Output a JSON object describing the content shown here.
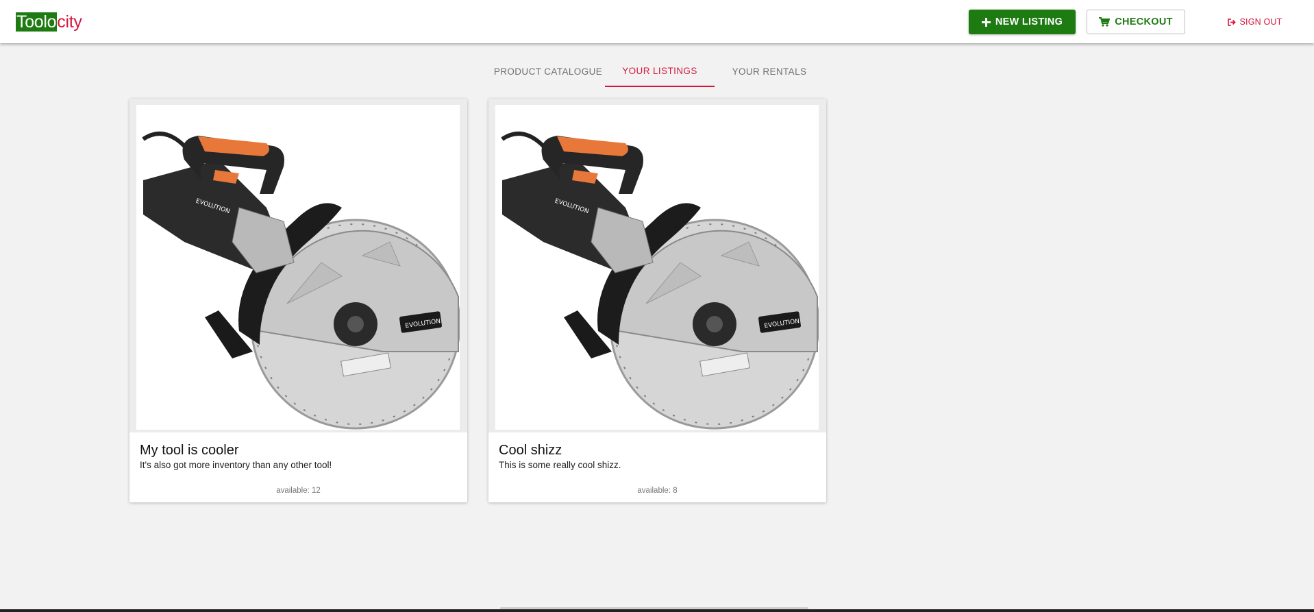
{
  "logo": {
    "part_highlight": "Toolo",
    "part_accent": "city"
  },
  "header": {
    "new_listing_label": "NEW LISTING",
    "checkout_label": "CHECKOUT",
    "sign_out_label": "SIGN OUT"
  },
  "tabs": [
    {
      "label": "PRODUCT CATALOGUE",
      "active": false
    },
    {
      "label": "YOUR LISTINGS",
      "active": true
    },
    {
      "label": "YOUR RENTALS",
      "active": false
    }
  ],
  "listings": [
    {
      "title": "My tool is cooler",
      "description": "It's also got more inventory than any other tool!",
      "availability": "available: 12",
      "image_icon": "concrete-saw-image"
    },
    {
      "title": "Cool shizz",
      "description": "This is some really cool shizz.",
      "availability": "available: 8",
      "image_icon": "concrete-saw-image"
    }
  ],
  "colors": {
    "brand_green": "#1e7b12",
    "brand_red": "#d6163f",
    "background": "#f2f2f2"
  }
}
